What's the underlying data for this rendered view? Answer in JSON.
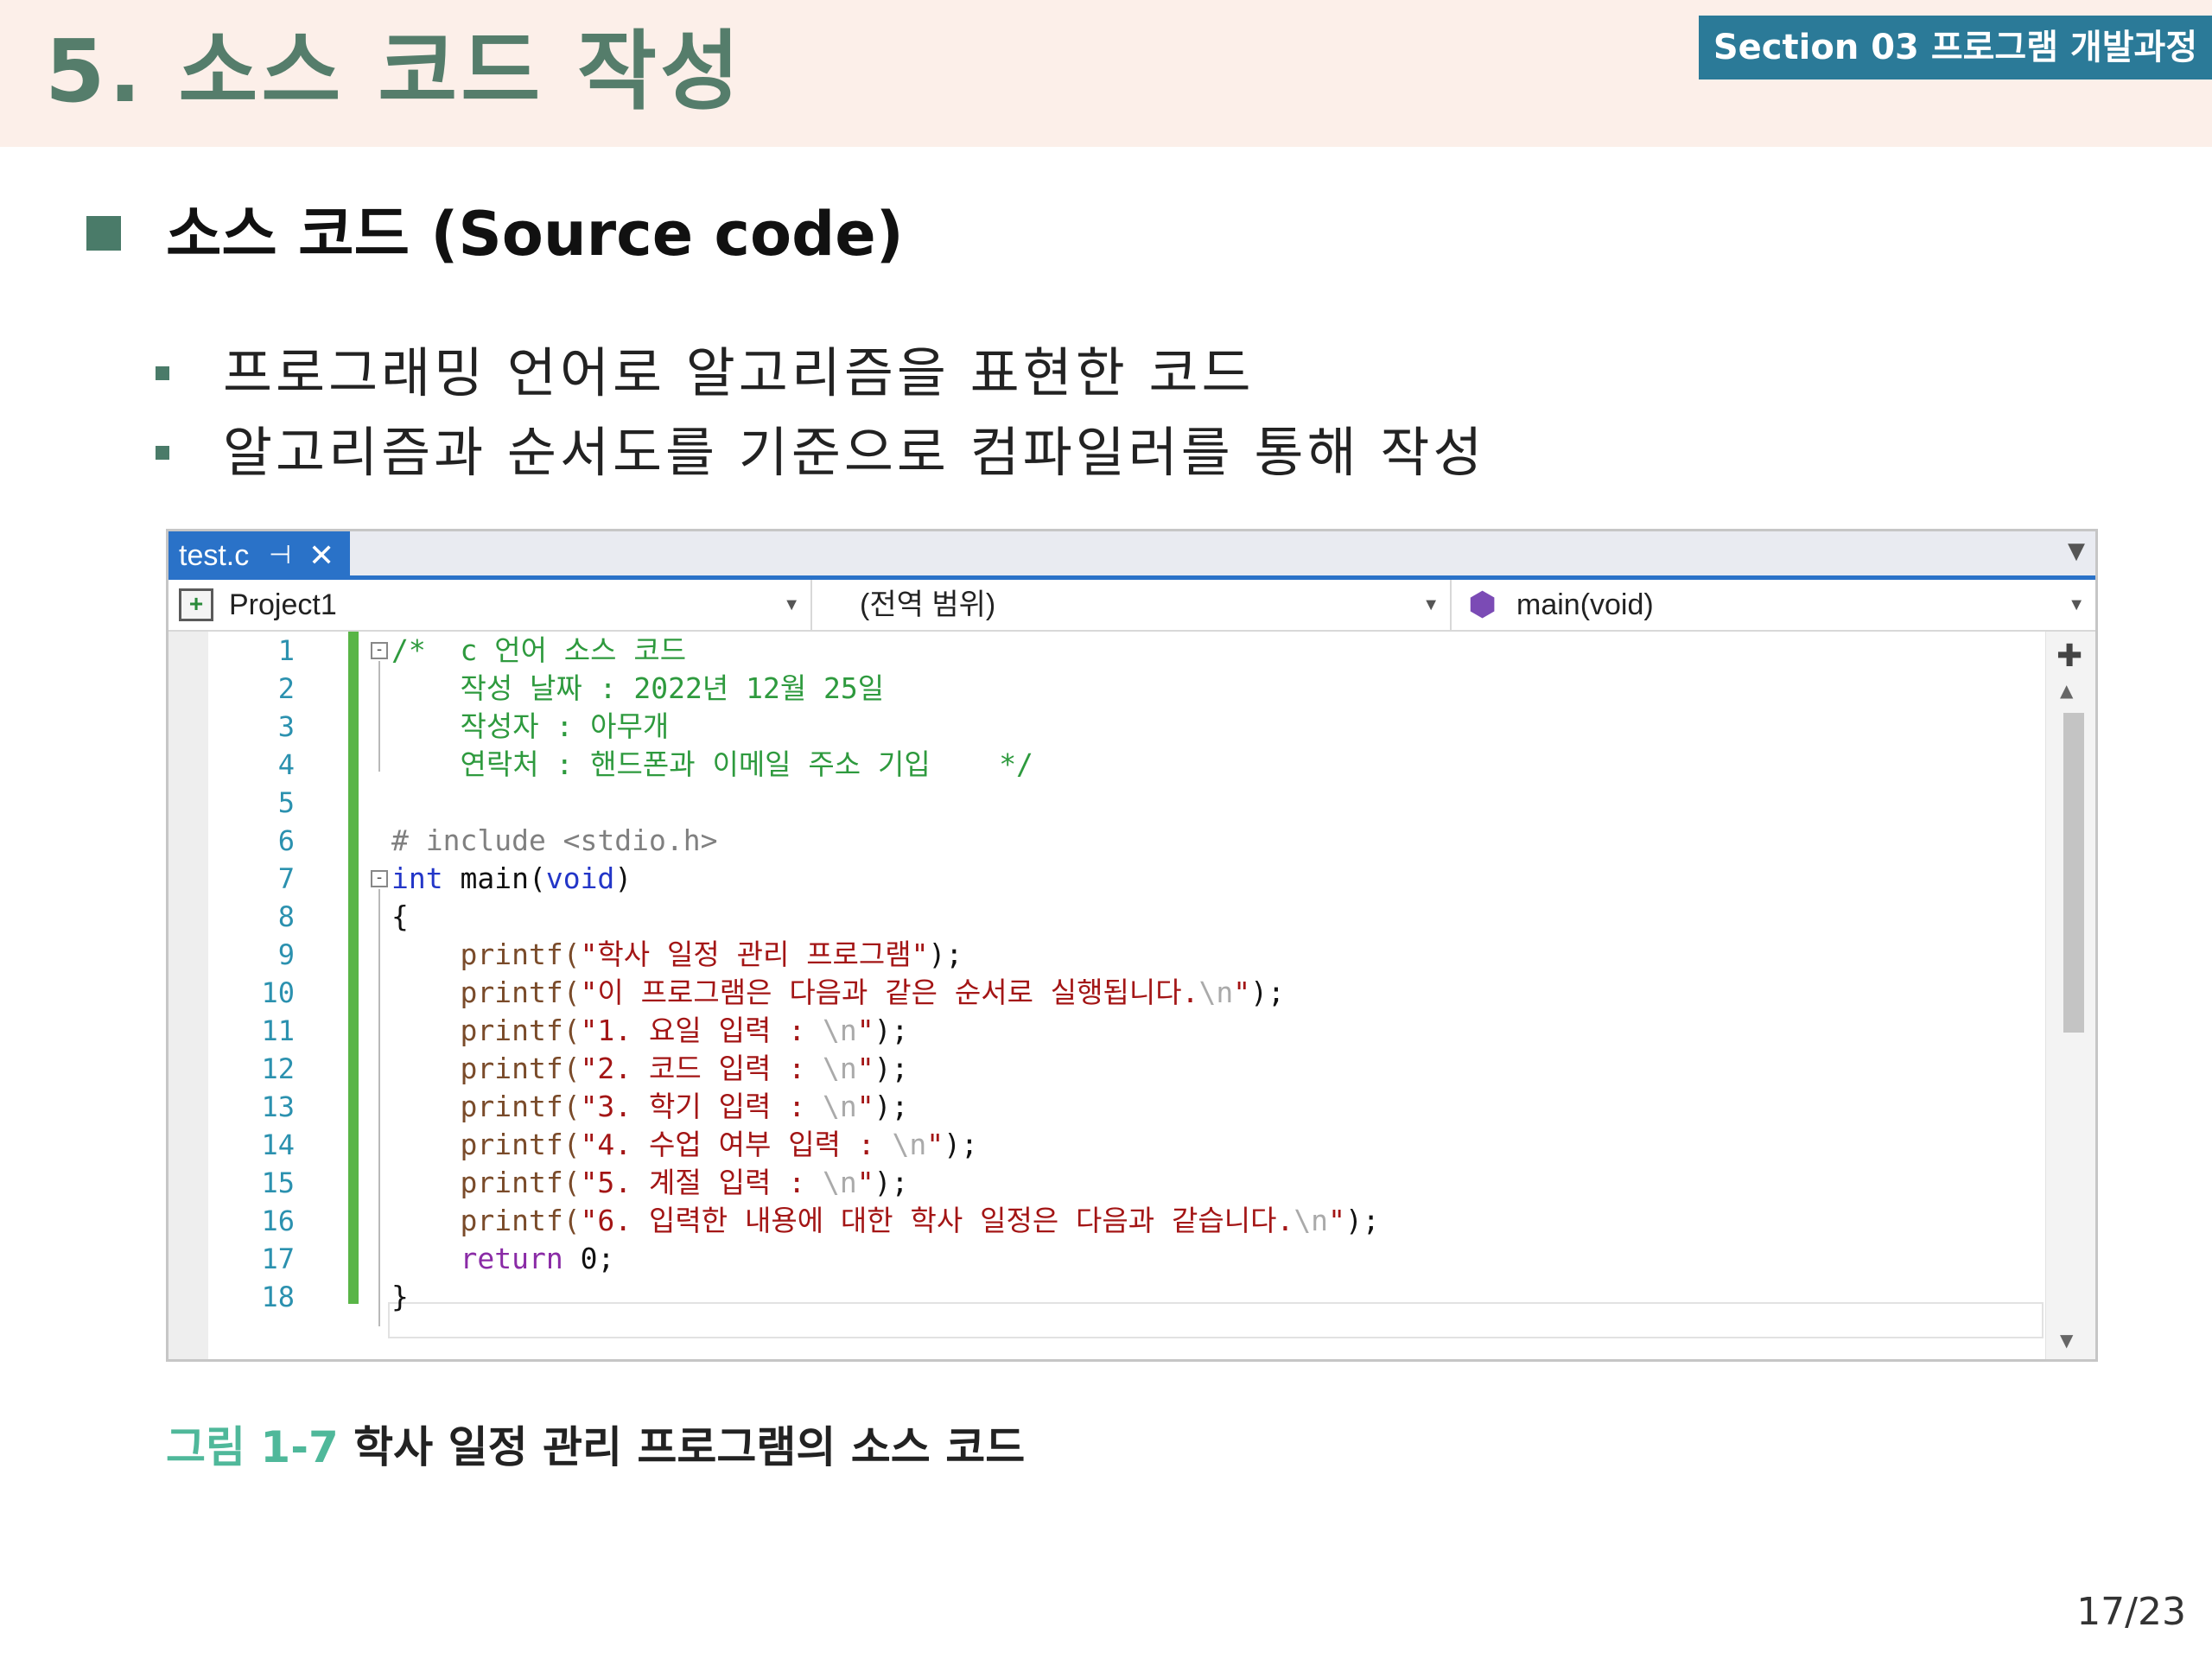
{
  "header": {
    "title": "5. 소스 코드 작성",
    "section_badge": "Section 03 프로그램 개발과정"
  },
  "heading": "소스 코드 (Source code)",
  "bullets": [
    "프로그래밍 언어로 알고리즘을 표현한 코드",
    "알고리즘과 순서도를 기준으로 컴파일러를 통해 작성"
  ],
  "ide": {
    "tab_label": "test.c",
    "tab_pin_glyph": "⊣",
    "tab_close_glyph": "✕",
    "project": "Project1",
    "scope": "(전역 범위)",
    "function": "main(void)",
    "line_numbers": [
      "1",
      "2",
      "3",
      "4",
      "5",
      "6",
      "7",
      "8",
      "9",
      "10",
      "11",
      "12",
      "13",
      "14",
      "15",
      "16",
      "17",
      "18"
    ],
    "code": {
      "l1": "/*  c 언어 소스 코드",
      "l2": "    작성 날짜 : 2022년 12월 25일",
      "l3": "    작성자 : 아무개",
      "l4": "    연락처 : 핸드폰과 이메일 주소 기입    */",
      "l6": "# include <stdio.h>",
      "l7_kw": "int",
      "l7_fn": " main(",
      "l7_arg": "void",
      "l7_end": ")",
      "l8": "{",
      "printf": "printf(",
      "l9_str": "\"학사 일정 관리 프로그램\"",
      "l10_str": "\"이 프로그램은 다음과 같은 순서로 실행됩니다.",
      "l11_str": "\"1. 요일 입력 : ",
      "l12_str": "\"2. 코드 입력 : ",
      "l13_str": "\"3. 학기 입력 : ",
      "l14_str": "\"4. 수업 여부 입력 : ",
      "l15_str": "\"5. 계절 입력 : ",
      "l16_str": "\"6. 입력한 내용에 대한 학사 일정은 다음과 같습니다.",
      "newline": "\\n",
      "quote_close": "\"",
      "stmt_end": ");",
      "l17_kw": "return",
      "l17_rest": " 0;",
      "l18": "}"
    }
  },
  "caption": {
    "number": "그림 1-7",
    "text": "학사 일정 관리 프로그램의 소스 코드"
  },
  "page_number": "17/23",
  "colors": {
    "header_band": "#fcefe9",
    "title": "#557d6b",
    "badge": "#2b7a98",
    "accent_marker": "#4a7b69",
    "ide_tab": "#2a72c8",
    "gutter_change": "#59b547",
    "caption_number": "#4fb89a"
  },
  "icons": {
    "project": "project-icon",
    "function": "function-cube-icon",
    "split": "split-handle-icon"
  }
}
